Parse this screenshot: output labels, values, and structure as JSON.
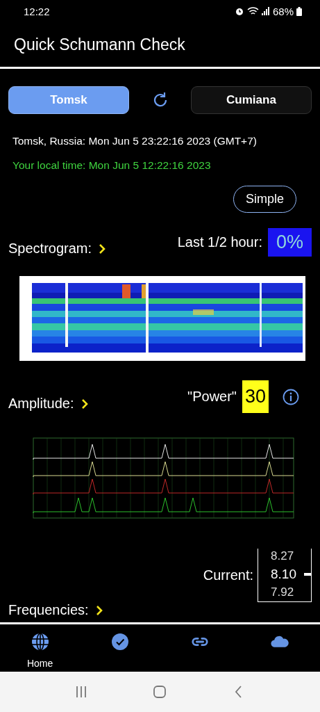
{
  "status_bar": {
    "time": "12:22",
    "battery": "68%"
  },
  "app_bar": {
    "title": "Quick Schumann Check"
  },
  "stations": [
    {
      "label": "Tomsk",
      "selected": true
    },
    {
      "label": "Cumiana",
      "selected": false
    }
  ],
  "station_time": "Tomsk, Russia: Mon Jun  5 23:22:16 2023 (GMT+7)",
  "local_time": "Your local time: Mon Jun  5 12:22:16 2023",
  "mode_button": "Simple",
  "spectrogram": {
    "label": "Spectrogram:",
    "last_label": "Last 1/2 hour:",
    "last_value": "0%"
  },
  "amplitude": {
    "label": "Amplitude:",
    "power_label": "\"Power\"",
    "power_value": "30"
  },
  "current": {
    "label": "Current:",
    "values": [
      {
        "text": "8.27",
        "selected": false
      },
      {
        "text": "8.10",
        "selected": true
      },
      {
        "text": "7.92",
        "selected": false
      }
    ]
  },
  "frequencies": {
    "label": "Frequencies:"
  },
  "bottom_nav": [
    {
      "kind": "globe",
      "label": "Home",
      "selected": true
    },
    {
      "kind": "check",
      "selected": false
    },
    {
      "kind": "link",
      "selected": false
    },
    {
      "kind": "cloud",
      "selected": false
    }
  ]
}
